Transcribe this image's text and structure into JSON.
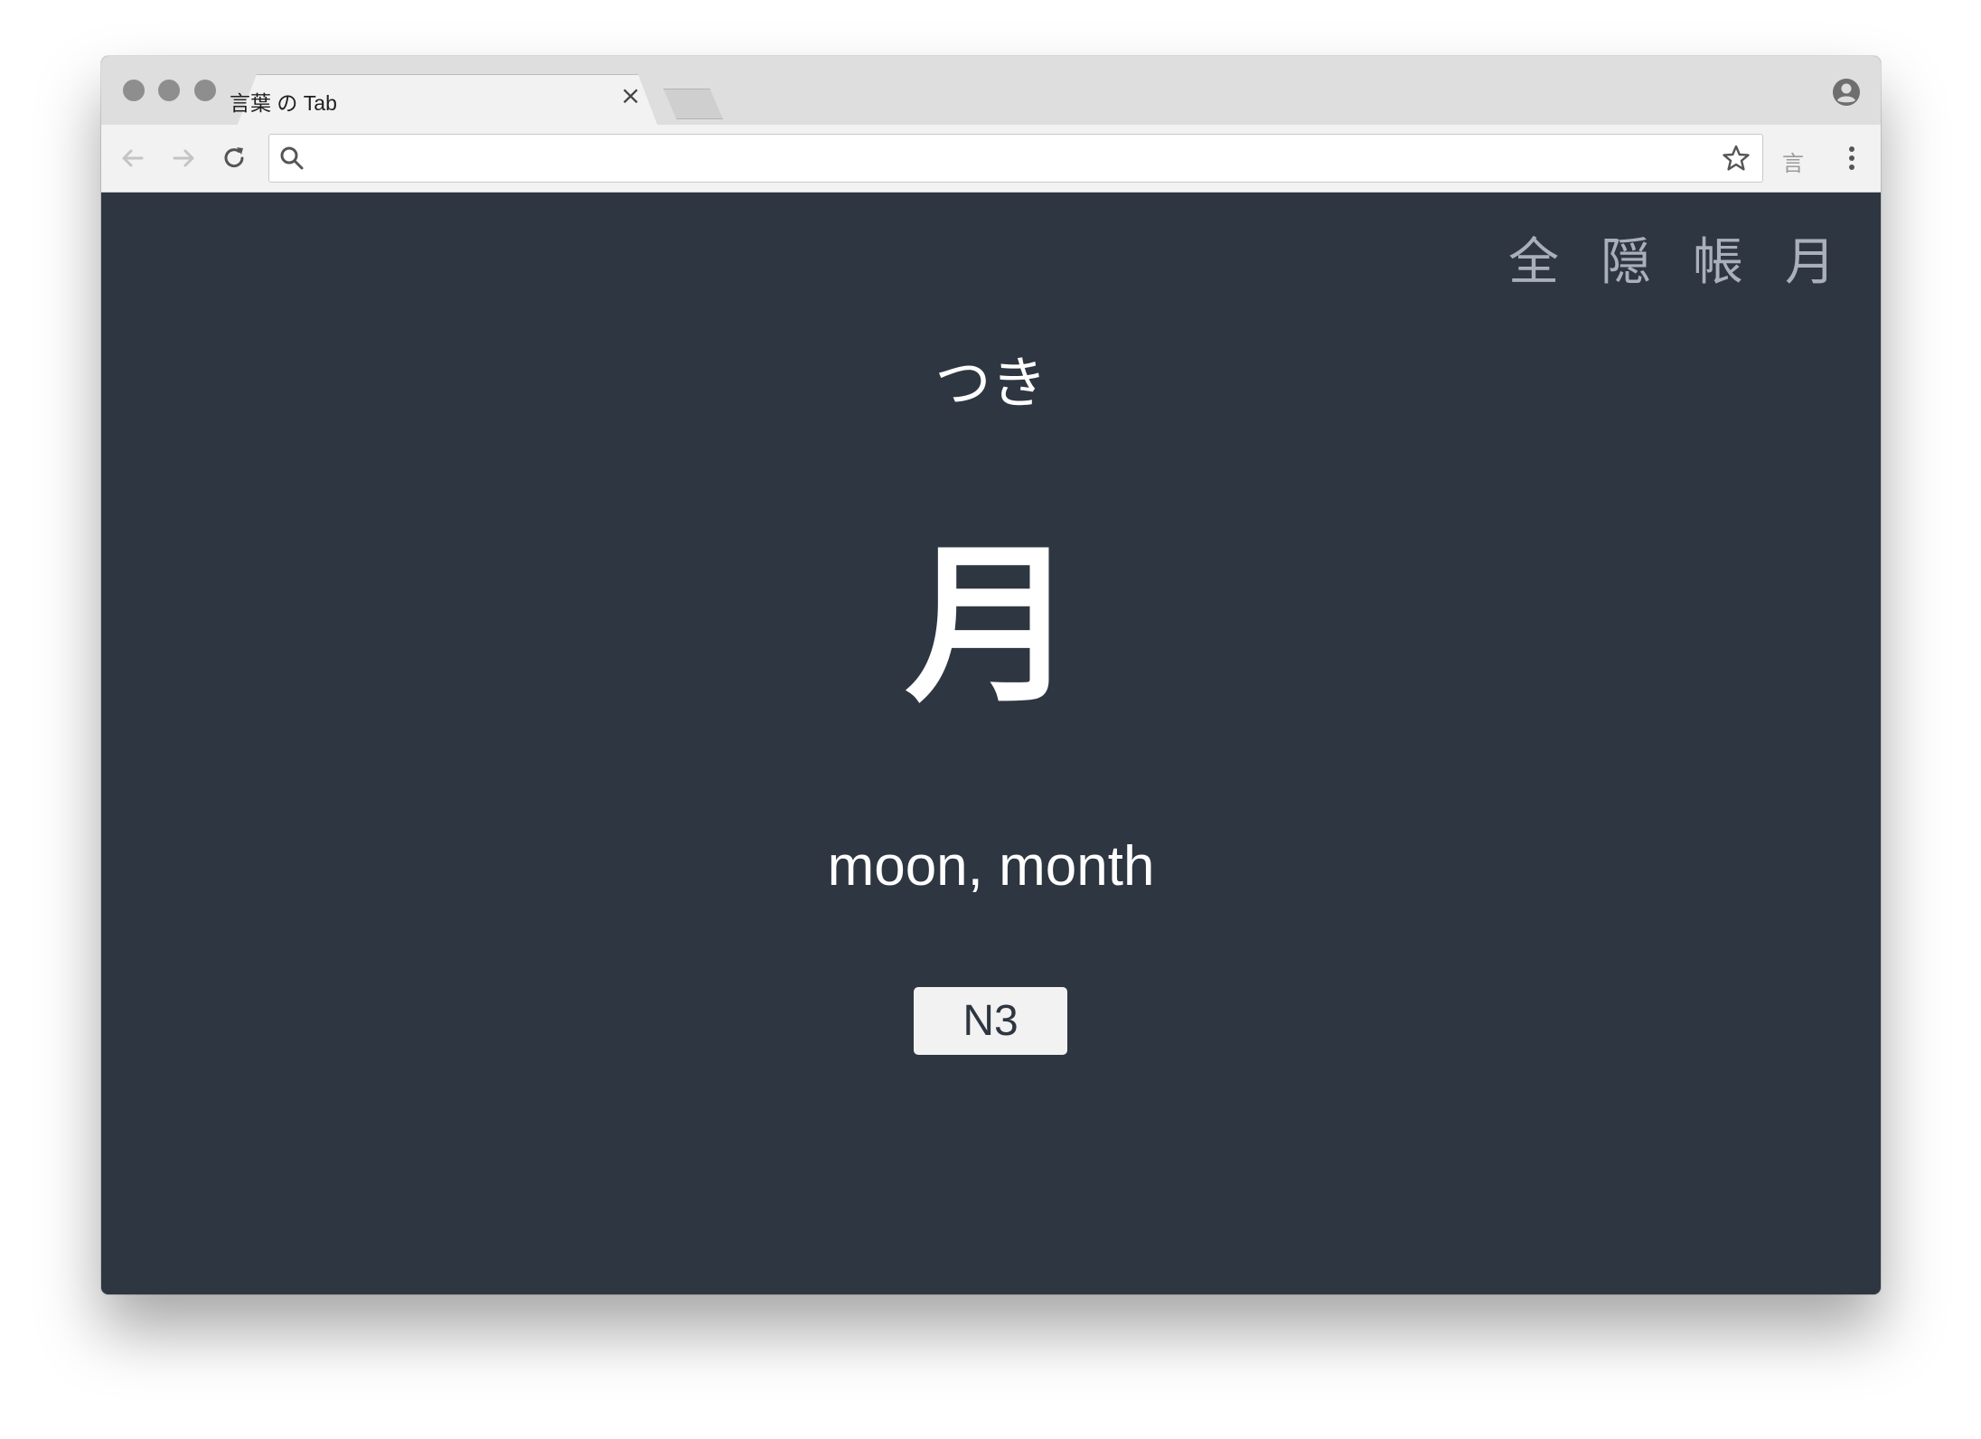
{
  "browser": {
    "tab_title": "言葉 の Tab",
    "tab_close": "×",
    "address": "",
    "extension_label": "言"
  },
  "header_links": [
    "全",
    "隠",
    "帳",
    "月"
  ],
  "card": {
    "reading": "つき",
    "kanji": "月",
    "meaning": "moon, month",
    "level": "N3"
  },
  "colors": {
    "content_bg": "#2e3641",
    "link_color": "#aab0bb",
    "text_color": "#ffffff",
    "badge_bg": "#f2f2f2"
  },
  "icons": [
    "back-arrow-icon",
    "forward-arrow-icon",
    "reload-icon",
    "search-icon",
    "star-icon",
    "kebab-menu-icon",
    "profile-icon"
  ]
}
